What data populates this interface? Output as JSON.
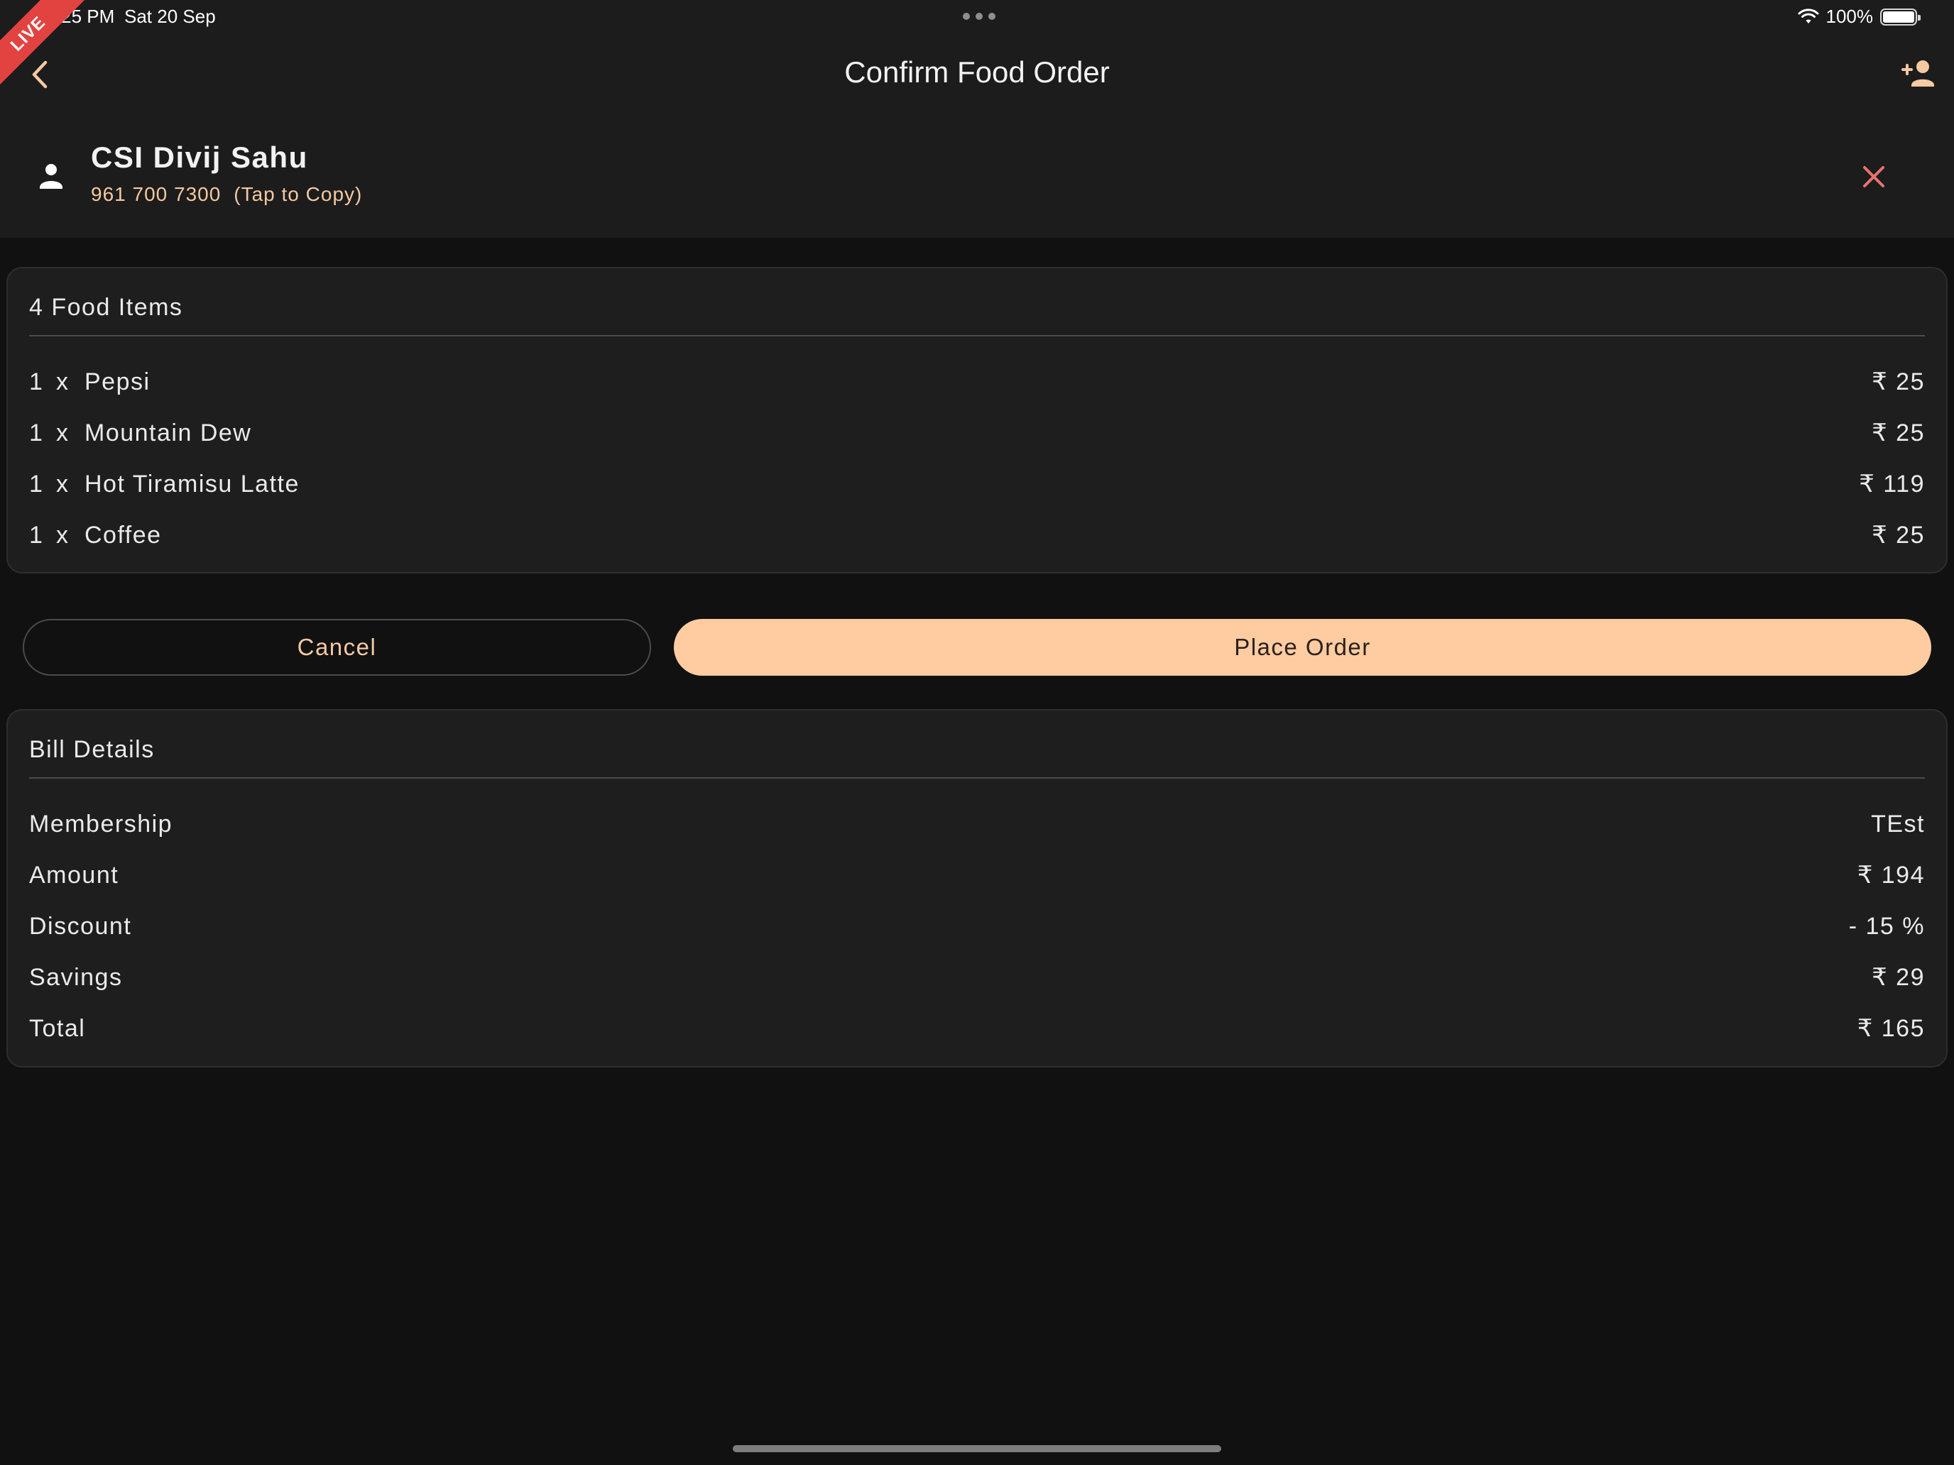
{
  "status_bar": {
    "time": "12:25 PM",
    "date": "Sat 20 Sep",
    "battery": "100%"
  },
  "live_badge": "LIVE",
  "nav": {
    "title": "Confirm Food Order",
    "back_icon": "chevron-left-icon",
    "add_user_icon": "person-add-icon"
  },
  "customer": {
    "name": "CSI Divij Sahu",
    "phone": "961 700 7300",
    "copy_hint": "(Tap to Copy)"
  },
  "food_items": {
    "header": "4 Food Items",
    "items": [
      {
        "qty": "1",
        "sep": "x",
        "name": "Pepsi",
        "price": "₹ 25"
      },
      {
        "qty": "1",
        "sep": "x",
        "name": "Mountain Dew",
        "price": "₹ 25"
      },
      {
        "qty": "1",
        "sep": "x",
        "name": "Hot Tiramisu Latte",
        "price": "₹ 119"
      },
      {
        "qty": "1",
        "sep": "x",
        "name": "Coffee",
        "price": "₹ 25"
      }
    ]
  },
  "actions": {
    "cancel_label": "Cancel",
    "place_order_label": "Place Order"
  },
  "bill": {
    "header": "Bill Details",
    "rows": [
      {
        "label": "Membership",
        "value": "TEst"
      },
      {
        "label": "Amount",
        "value": "₹ 194"
      },
      {
        "label": "Discount",
        "value": "- 15 %"
      },
      {
        "label": "Savings",
        "value": "₹ 29"
      },
      {
        "label": "Total",
        "value": "₹ 165"
      }
    ]
  },
  "colors": {
    "accent": "#ffcca1",
    "accent_text": "#f5c9a1",
    "danger": "#e8736f",
    "background": "#111111",
    "surface": "#1e1e1e"
  }
}
